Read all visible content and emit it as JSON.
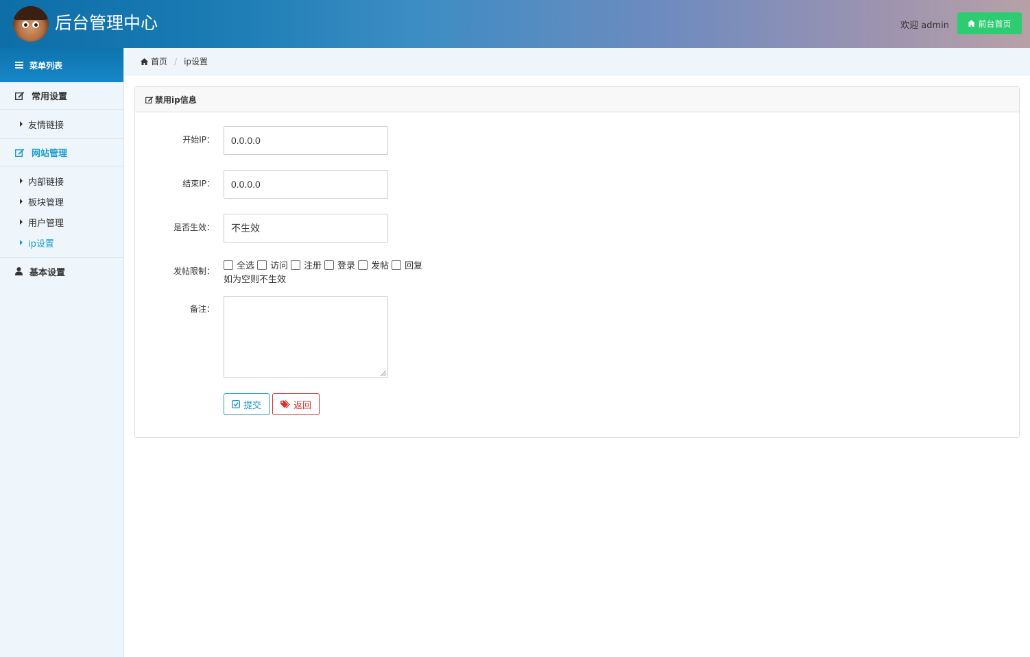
{
  "header": {
    "title": "后台管理中心",
    "welcome": "欢迎 admin",
    "home_button": "前台首页"
  },
  "sidebar": {
    "menu_title": "菜单列表",
    "groups": [
      {
        "label": "常用设置",
        "icon": "edit-icon",
        "items": [
          {
            "label": "友情链接"
          }
        ]
      },
      {
        "label": "网站管理",
        "icon": "edit-icon",
        "active": true,
        "items": [
          {
            "label": "内部链接"
          },
          {
            "label": "板块管理"
          },
          {
            "label": "用户管理"
          },
          {
            "label": "ip设置",
            "active": true
          }
        ]
      },
      {
        "label": "基本设置",
        "icon": "user-icon",
        "items": []
      }
    ]
  },
  "breadcrumb": {
    "home": "首页",
    "current": "ip设置"
  },
  "panel": {
    "title": "禁用ip信息",
    "fields": {
      "start_ip": {
        "label": "开始IP：",
        "value": "0.0.0.0"
      },
      "end_ip": {
        "label": "结束IP：",
        "value": "0.0.0.0"
      },
      "enabled": {
        "label": "是否生效：",
        "value": "不生效"
      },
      "post_limit": {
        "label": "发帖限制：",
        "options": [
          "全选",
          "访问",
          "注册",
          "登录",
          "发帖",
          "回复"
        ],
        "hint": "如为空则不生效"
      },
      "remark": {
        "label": "备注：",
        "value": ""
      }
    },
    "submit_label": "提交",
    "back_label": "返回"
  },
  "colors": {
    "accent": "#1a9bd0",
    "home_button": "#2dcc70",
    "submit": "#2196c9",
    "back": "#d9302c"
  }
}
